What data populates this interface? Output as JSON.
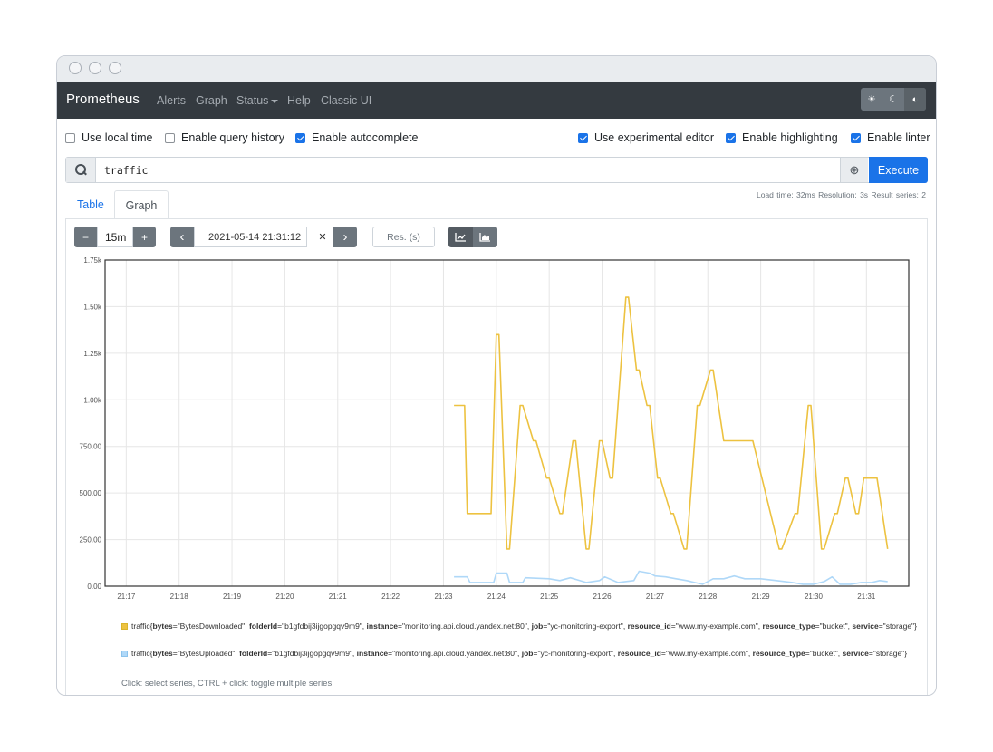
{
  "app": {
    "brand": "Prometheus",
    "nav": [
      "Alerts",
      "Graph",
      "Status",
      "Help",
      "Classic UI"
    ]
  },
  "options": {
    "local_time": {
      "label": "Use local time",
      "checked": false
    },
    "query_history": {
      "label": "Enable query history",
      "checked": false
    },
    "autocomplete": {
      "label": "Enable autocomplete",
      "checked": true
    },
    "experimental_editor": {
      "label": "Use experimental editor",
      "checked": true
    },
    "highlighting": {
      "label": "Enable highlighting",
      "checked": true
    },
    "linter": {
      "label": "Enable linter",
      "checked": true
    }
  },
  "query": {
    "value": "traffic",
    "execute_label": "Execute"
  },
  "tabs": {
    "table": "Table",
    "graph": "Graph"
  },
  "stats": "Load time: 32ms   Resolution: 3s   Result series: 2",
  "controls": {
    "range": "15m",
    "minus": "−",
    "plus": "+",
    "prev": "‹",
    "next": "›",
    "end_time": "2021-05-14 21:31:12",
    "clear": "✕",
    "resolution_placeholder": "Res. (s)"
  },
  "colors": {
    "downloaded": "#edc240",
    "uploaded": "#afd8f8",
    "accent": "#1a73e8"
  },
  "chart_data": {
    "type": "line",
    "ylim": [
      0,
      1750
    ],
    "xlim_minutes": [
      1016.6,
      1031.8
    ],
    "y_ticks": [
      0,
      250,
      500,
      750,
      1000,
      1250,
      1500,
      1750
    ],
    "y_tick_labels": [
      "0.00",
      "250.00",
      "500.00",
      "750.00",
      "1.00k",
      "1.25k",
      "1.50k",
      "1.75k"
    ],
    "x_ticks": [
      1017,
      1018,
      1019,
      1020,
      1021,
      1022,
      1023,
      1024,
      1025,
      1026,
      1027,
      1028,
      1029,
      1030,
      1031
    ],
    "x_tick_labels": [
      "21:17",
      "21:18",
      "21:19",
      "21:20",
      "21:21",
      "21:22",
      "21:23",
      "21:24",
      "21:25",
      "21:26",
      "21:27",
      "21:28",
      "21:29",
      "21:30",
      "21:31"
    ],
    "grid": true,
    "series": [
      {
        "name": "traffic{bytes=\"BytesDownloaded\", folderId=\"b1gfdbij3ijgopgqv9m9\", instance=\"monitoring.api.cloud.yandex.net:80\", job=\"yc-monitoring-export\", resource_id=\"www.my-example.com\", resource_type=\"bucket\", service=\"storage\"}",
        "color": "#edc240",
        "x": [
          1023.2,
          1023.4,
          1023.45,
          1023.9,
          1024.0,
          1024.05,
          1024.2,
          1024.25,
          1024.45,
          1024.5,
          1024.7,
          1024.75,
          1024.95,
          1025.0,
          1025.2,
          1025.25,
          1025.45,
          1025.5,
          1025.7,
          1025.75,
          1025.95,
          1026.0,
          1026.15,
          1026.2,
          1026.45,
          1026.5,
          1026.65,
          1026.7,
          1026.85,
          1026.9,
          1027.05,
          1027.1,
          1027.3,
          1027.35,
          1027.55,
          1027.6,
          1027.8,
          1027.85,
          1028.05,
          1028.1,
          1028.3,
          1028.35,
          1028.55,
          1028.6,
          1028.8,
          1028.85,
          1029.35,
          1029.4,
          1029.65,
          1029.7,
          1029.9,
          1029.95,
          1030.15,
          1030.2,
          1030.4,
          1030.45,
          1030.6,
          1030.65,
          1030.8,
          1030.85,
          1030.95,
          1031.0,
          1031.15,
          1031.2,
          1031.4
        ],
        "y": [
          970,
          970,
          390,
          390,
          1350,
          1350,
          200,
          200,
          970,
          970,
          780,
          780,
          580,
          580,
          390,
          390,
          780,
          780,
          200,
          200,
          780,
          780,
          580,
          580,
          1550,
          1550,
          1160,
          1160,
          970,
          970,
          580,
          580,
          390,
          390,
          200,
          200,
          970,
          970,
          1160,
          1160,
          780,
          780,
          780,
          780,
          780,
          780,
          200,
          200,
          390,
          390,
          970,
          970,
          200,
          200,
          390,
          390,
          580,
          580,
          390,
          390,
          580,
          580,
          580,
          580,
          200
        ]
      },
      {
        "name": "traffic{bytes=\"BytesUploaded\", folderId=\"b1gfdbij3ijgopgqv9m9\", instance=\"monitoring.api.cloud.yandex.net:80\", job=\"yc-monitoring-export\", resource_id=\"www.my-example.com\", resource_type=\"bucket\", service=\"storage\"}",
        "color": "#afd8f8",
        "x": [
          1023.2,
          1023.45,
          1023.5,
          1023.95,
          1024.0,
          1024.2,
          1024.25,
          1024.5,
          1024.55,
          1025.0,
          1025.2,
          1025.4,
          1025.7,
          1025.95,
          1026.05,
          1026.3,
          1026.6,
          1026.7,
          1026.9,
          1027.0,
          1027.2,
          1027.4,
          1027.6,
          1027.9,
          1028.1,
          1028.3,
          1028.5,
          1028.7,
          1029.0,
          1029.3,
          1029.6,
          1029.8,
          1030.0,
          1030.2,
          1030.35,
          1030.5,
          1030.7,
          1030.9,
          1031.1,
          1031.25,
          1031.4
        ],
        "y": [
          50,
          50,
          20,
          20,
          70,
          70,
          20,
          20,
          45,
          40,
          30,
          45,
          20,
          30,
          50,
          20,
          30,
          80,
          70,
          55,
          50,
          40,
          30,
          10,
          40,
          40,
          55,
          40,
          40,
          30,
          20,
          10,
          10,
          25,
          50,
          10,
          10,
          20,
          20,
          30,
          25
        ]
      }
    ],
    "legend": [
      {
        "metric": "traffic",
        "labels": [
          [
            "bytes",
            "BytesDownloaded"
          ],
          [
            "folderId",
            "b1gfdbij3ijgopgqv9m9"
          ],
          [
            "instance",
            "monitoring.api.cloud.yandex.net:80"
          ],
          [
            "job",
            "yc-monitoring-export"
          ],
          [
            "resource_id",
            "www.my-example.com"
          ],
          [
            "resource_type",
            "bucket"
          ],
          [
            "service",
            "storage"
          ]
        ]
      },
      {
        "metric": "traffic",
        "labels": [
          [
            "bytes",
            "BytesUploaded"
          ],
          [
            "folderId",
            "b1gfdbij3ijgopgqv9m9"
          ],
          [
            "instance",
            "monitoring.api.cloud.yandex.net:80"
          ],
          [
            "job",
            "yc-monitoring-export"
          ],
          [
            "resource_id",
            "www.my-example.com"
          ],
          [
            "resource_type",
            "bucket"
          ],
          [
            "service",
            "storage"
          ]
        ]
      }
    ]
  },
  "hint": "Click: select series, CTRL + click: toggle multiple series"
}
